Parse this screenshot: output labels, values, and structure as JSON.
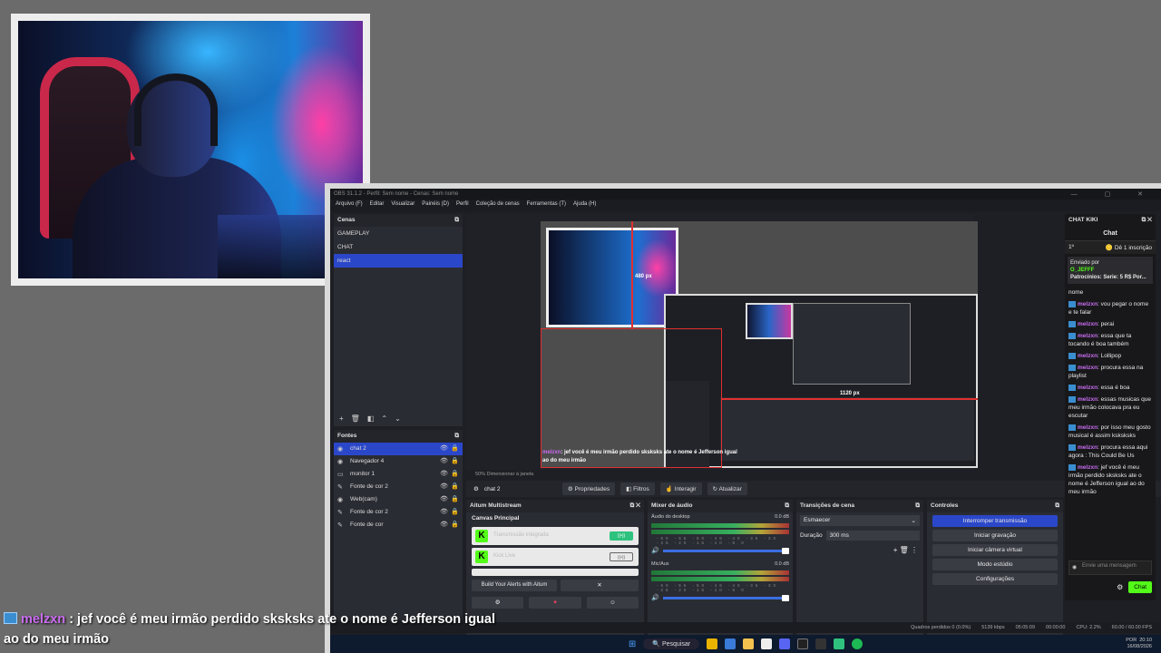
{
  "obs": {
    "title": "OBS 31.1.2 - Perfil: Sem nome - Cenas: Sem nome",
    "menu": [
      "Arquivo (F)",
      "Editar",
      "Visualizar",
      "Painéis (D)",
      "Perfil",
      "Coleção de cenas",
      "Ferramentas (T)",
      "Ajuda (H)"
    ],
    "scenes_title": "Cenas",
    "scenes": [
      "GAMEPLAY",
      "CHAT",
      "react"
    ],
    "sources_title": "Fontes",
    "sources": [
      "chat 2",
      "Navegador 4",
      "monitor 1",
      "Fonte de cor 2",
      "Web(cam)",
      "Fonte de cor 2",
      "Fonte de cor"
    ],
    "preview_label_width": "480 px",
    "preview_label_height": "1120 px",
    "preview_footer": "50%   Dimensionar à janela",
    "selected_source": "chat 2",
    "source_buttons": [
      "Propriedades",
      "Filtros",
      "Interagir",
      "Atualizar"
    ],
    "multistream_title": "Aitum Multistream",
    "canvas_principal": "Canvas Principal",
    "multistream_items": [
      "Transmissão integrada",
      "Kick Live"
    ],
    "build_alerts": "Build Your Alerts with Aitum",
    "mixer_title": "Mixer de áudio",
    "mixer_tracks": [
      {
        "name": "Áudio do desktop",
        "level": "0.0 dB"
      },
      {
        "name": "Mic/Aux",
        "level": "0.0 dB"
      }
    ],
    "mixer_scale": "-60 -55 -50 -45 -40 -35 -30 -25 -20 -15 -10 -5 0",
    "transitions_title": "Transições de cena",
    "transition_type": "Esmaecer",
    "duration_label": "Duração",
    "duration_value": "300 ms",
    "controls_title": "Controles",
    "controls": [
      "Interromper transmissão",
      "Iniciar gravação",
      "Iniciar câmera virtual",
      "Modo estúdio",
      "Configurações"
    ],
    "chat_title": "CHAT KIKI",
    "chat_tab": "Chat",
    "chat_rank": "1º",
    "chat_gift": "Dê 1 inscrição",
    "chat_pinned_from": "Enviado por",
    "chat_pinned_user": "O_JEFFF",
    "chat_pinned_text": "Patrocínios: Serie: 5 R$ Por...",
    "chat_pinned_more": "nome",
    "chat_messages": [
      {
        "user": "melzxn",
        "text": "vou pegar o nome e te falar"
      },
      {
        "user": "melzxn",
        "text": "perai"
      },
      {
        "user": "melzxn",
        "text": "essa que ta tocando é boa também"
      },
      {
        "user": "melzxn",
        "text": "Lollipop"
      },
      {
        "user": "melzxn",
        "text": "procura essa na playlist"
      },
      {
        "user": "melzxn",
        "text": "essa é boa"
      },
      {
        "user": "melzxn",
        "text": "essas musicas que meu irmão colocava pra eu escutar"
      },
      {
        "user": "melzxn",
        "text": "por isso meu gosto musical é assim ksksksks"
      },
      {
        "user": "melzxn",
        "text": "procura essa aqui agora : This Could Be Us"
      },
      {
        "user": "melzxn",
        "text": "jef você é meu irmão perdido sksksks ate o nome é Jefferson igual ao do meu irmão"
      }
    ],
    "chat_input_placeholder": "Envie uma mensagem",
    "chat_send": "Chat",
    "status": {
      "dropped": "Quadros perdidos 0 (0.0%)",
      "bitrate": "5139 kbps",
      "live_time": "05:05:09",
      "rec_time": "00:00:00",
      "cpu": "CPU: 2.2%",
      "fps": "60.00 / 60.00 FPS"
    },
    "taskbar": {
      "search": "Pesquisar",
      "lang": "POR",
      "time": "20:10",
      "date": "16/08/2026"
    }
  },
  "caption": {
    "user": "melzxn",
    "line1": ": jef você é meu irmão perdido sksksks ate o nome é Jefferson igual",
    "line2": "ao do meu irmão"
  }
}
